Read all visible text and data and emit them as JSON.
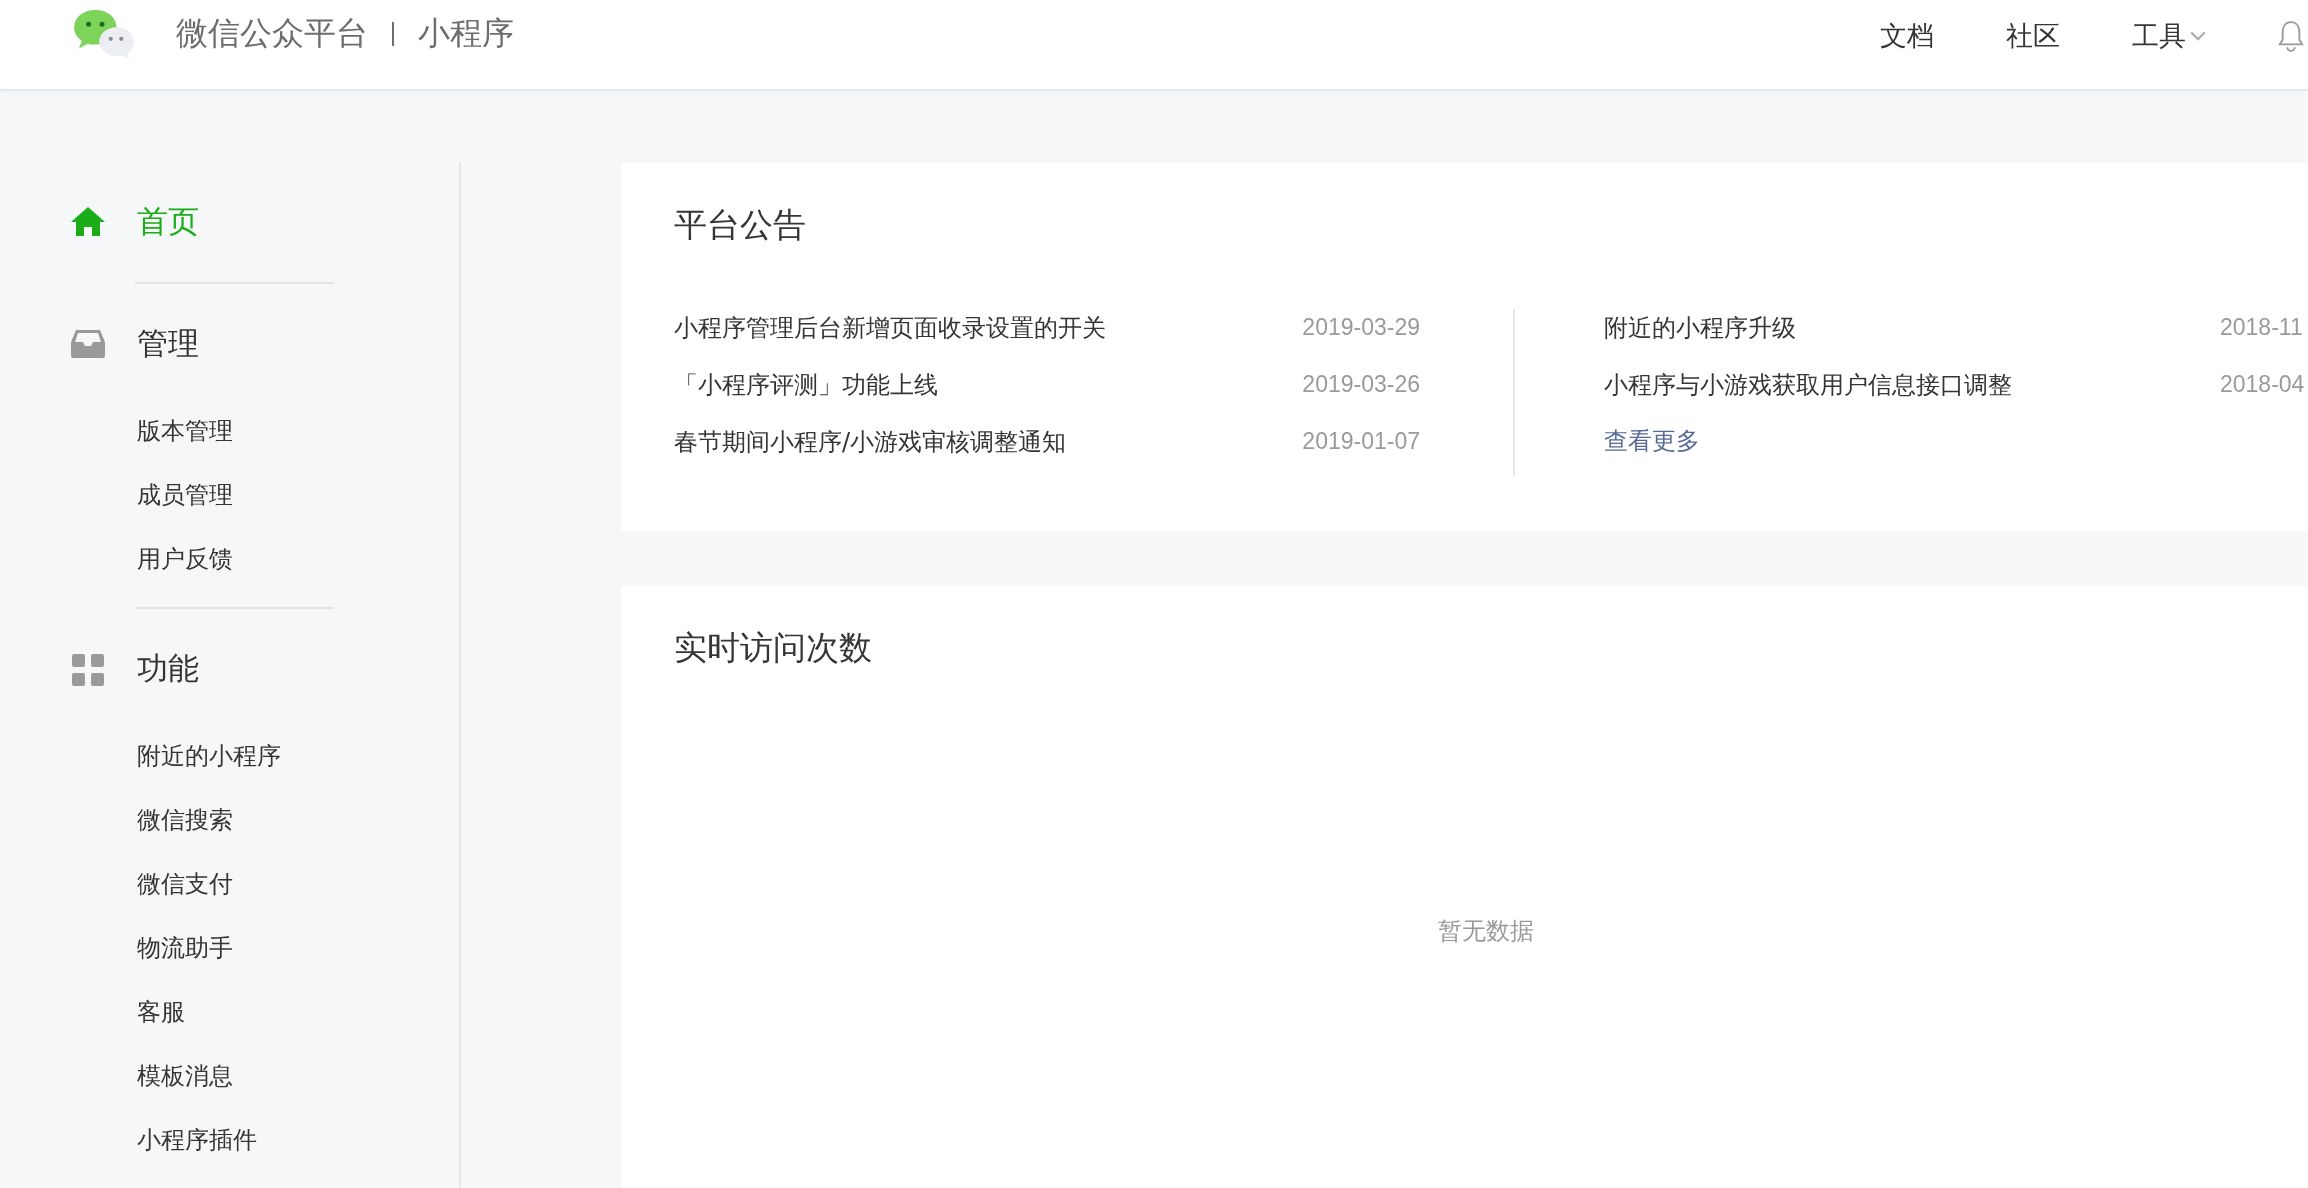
{
  "header": {
    "platform": "微信公众平台",
    "product": "小程序",
    "nav": [
      {
        "label": "文档",
        "dropdown": false
      },
      {
        "label": "社区",
        "dropdown": false
      },
      {
        "label": "工具",
        "dropdown": true
      }
    ]
  },
  "sidebar": {
    "sections": [
      {
        "label": "首页",
        "kind": "home",
        "selected": true
      },
      {
        "label": "管理",
        "kind": "inbox",
        "selected": false,
        "items": [
          {
            "label": "版本管理",
            "selected": false
          },
          {
            "label": "成员管理",
            "selected": false
          },
          {
            "label": "用户反馈",
            "selected": false
          }
        ]
      },
      {
        "label": "功能",
        "kind": "grid",
        "selected": false,
        "items": [
          {
            "label": "附近的小程序",
            "selected": false
          },
          {
            "label": "微信搜索",
            "selected": false
          },
          {
            "label": "微信支付",
            "selected": false
          },
          {
            "label": "物流助手",
            "selected": false
          },
          {
            "label": "客服",
            "selected": false
          },
          {
            "label": "模板消息",
            "selected": false
          },
          {
            "label": "小程序插件",
            "selected": false
          }
        ]
      }
    ]
  },
  "announcements": {
    "title": "平台公告",
    "columns": [
      {
        "items": [
          {
            "title": "小程序管理后台新增页面收录设置的开关",
            "date": "2019-03-29"
          },
          {
            "title": "「小程序评测」功能上线",
            "date": "2019-03-26"
          },
          {
            "title": "春节期间小程序/小游戏审核调整通知",
            "date": "2019-01-07"
          }
        ]
      },
      {
        "items": [
          {
            "title": "附近的小程序升级",
            "date": "2018-11"
          },
          {
            "title": "小程序与小游戏获取用户信息接口调整",
            "date": "2018-04"
          }
        ],
        "more": "查看更多"
      }
    ]
  },
  "realtime_visits": {
    "title": "实时访问次数",
    "empty_text": "暂无数据"
  }
}
